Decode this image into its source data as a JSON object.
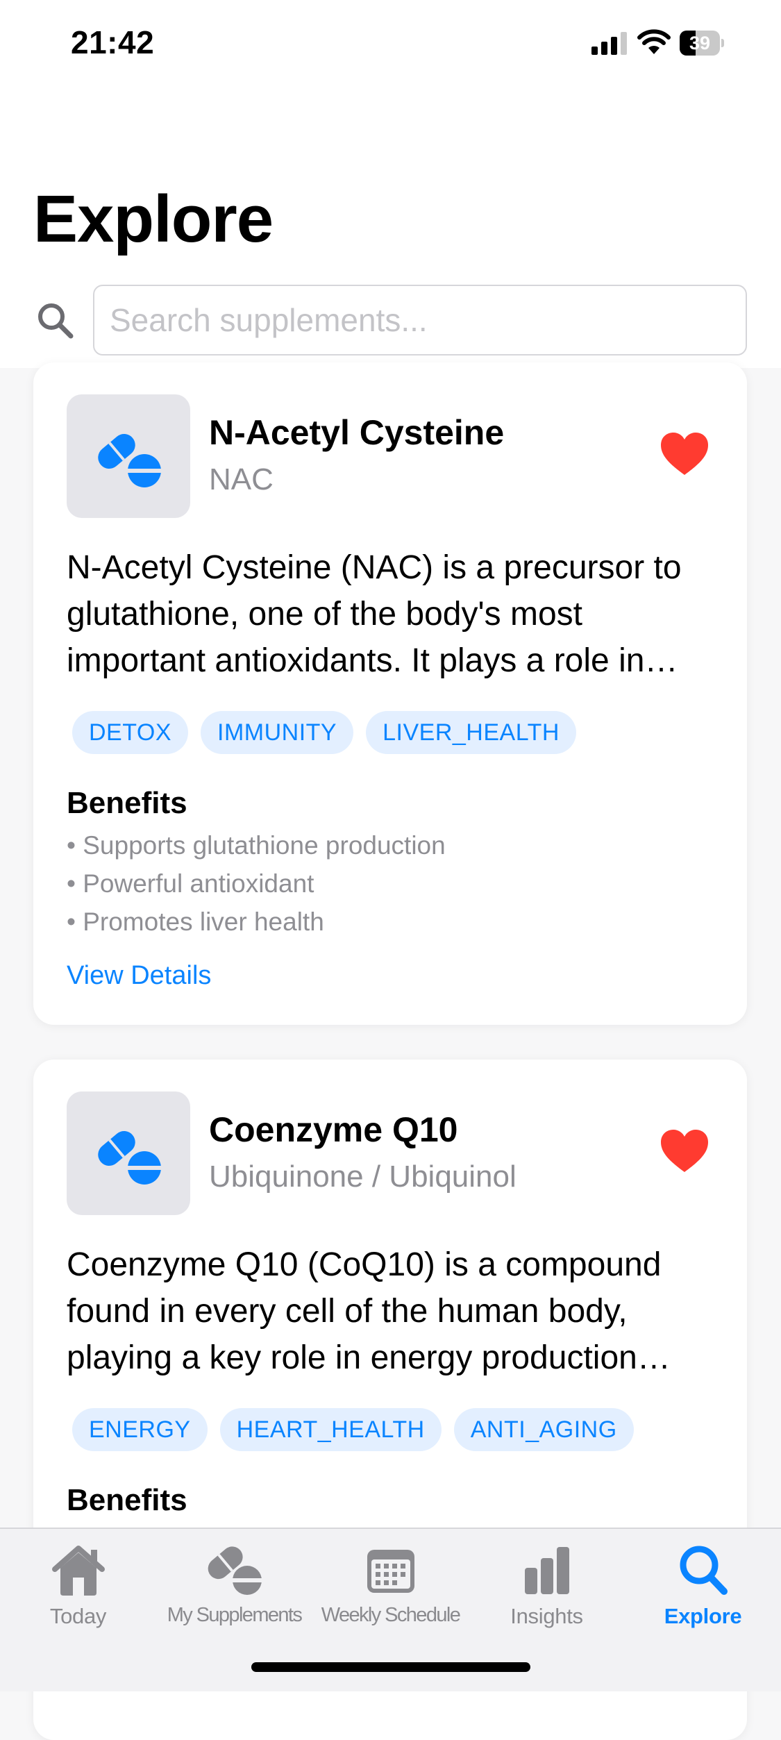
{
  "status_bar": {
    "time": "21:42",
    "battery_level": "39"
  },
  "header": {
    "title": "Explore"
  },
  "search": {
    "placeholder": "Search supplements...",
    "value": ""
  },
  "supplements": [
    {
      "name": "N-Acetyl Cysteine",
      "alias": "NAC",
      "favorited": true,
      "description": "N-Acetyl Cysteine (NAC) is a precursor to glutathione, one of the body's most important antioxidants. It plays a role in detoxification, immune function and liver health.",
      "tags": [
        "DETOX",
        "IMMUNITY",
        "LIVER_HEALTH"
      ],
      "benefits_title": "Benefits",
      "benefits": [
        "Supports glutathione production",
        "Powerful antioxidant",
        "Promotes liver health"
      ],
      "link_label": "View Details"
    },
    {
      "name": "Coenzyme Q10",
      "alias": "Ubiquinone / Ubiquinol",
      "favorited": true,
      "description": "Coenzyme Q10 (CoQ10) is a compound found in every cell of the human body, playing a key role in energy production within the mitochondria.",
      "tags": [
        "ENERGY",
        "HEART_HEALTH",
        "ANTI_AGING"
      ],
      "benefits_title": "Benefits"
    }
  ],
  "tab_bar": {
    "tabs": [
      {
        "label": "Today",
        "icon": "house-icon"
      },
      {
        "label": "My Supplements",
        "icon": "pills-icon"
      },
      {
        "label": "Weekly Schedule",
        "icon": "calendar-icon"
      },
      {
        "label": "Insights",
        "icon": "bar-chart-icon"
      },
      {
        "label": "Explore",
        "icon": "magnifying-glass-icon",
        "active": true
      }
    ]
  },
  "colors": {
    "accent": "#0a84ff",
    "favorite": "#ff3b30",
    "tag_background": "#e3efff",
    "secondary_text": "#8e8e93",
    "background": "#f7f7f8"
  }
}
